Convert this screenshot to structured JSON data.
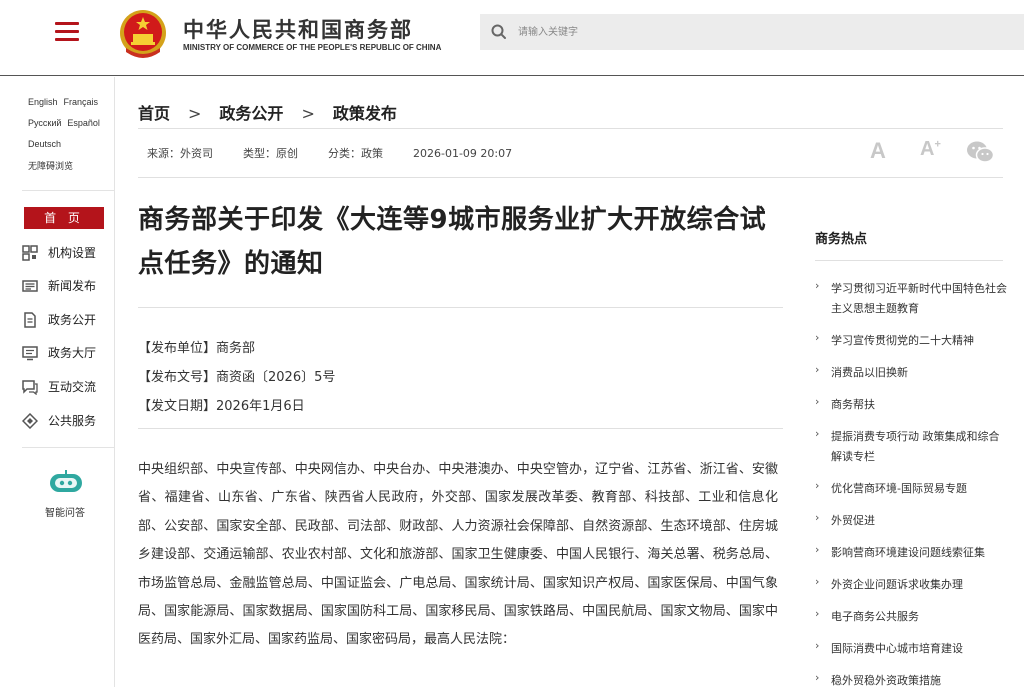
{
  "header": {
    "site_name_cn": "中华人民共和国商务部",
    "site_name_en": "MINISTRY OF COMMERCE OF THE PEOPLE'S REPUBLIC OF CHINA",
    "search_placeholder": "请输入关键字",
    "brand_color": "#b4141b"
  },
  "sidebar": {
    "languages": [
      [
        "English",
        "Français"
      ],
      [
        "Русский",
        "Español"
      ],
      [
        "Deutsch"
      ],
      [
        "无障碍浏览"
      ]
    ],
    "home_label": "首 页",
    "nav": [
      {
        "label": "机构设置",
        "icon": "grid-icon"
      },
      {
        "label": "新闻发布",
        "icon": "newspaper-icon"
      },
      {
        "label": "政务公开",
        "icon": "document-icon"
      },
      {
        "label": "政务大厅",
        "icon": "monitor-icon"
      },
      {
        "label": "互动交流",
        "icon": "chat-icon"
      },
      {
        "label": "公共服务",
        "icon": "service-icon"
      }
    ],
    "assistant_label": "智能问答"
  },
  "breadcrumb": [
    "首页",
    "政务公开",
    "政策发布"
  ],
  "meta": {
    "source": "来源：外资司",
    "type": "类型：原创",
    "category": "分类：政策",
    "datetime": "2026-01-09 20:07"
  },
  "tools": {
    "font_large": "A",
    "font_small": "A",
    "font_plus": "+"
  },
  "article": {
    "title": "商务部关于印发《大连等9城市服务业扩大开放综合试点任务》的通知",
    "issuer": "【发布单位】商务部",
    "doc_number": "【发布文号】商资函〔2026〕5号",
    "issue_date": "【发文日期】2026年1月6日",
    "body": "中央组织部、中央宣传部、中央网信办、中央台办、中央港澳办、中央空管办，辽宁省、江苏省、浙江省、安徽省、福建省、山东省、广东省、陕西省人民政府，外交部、国家发展改革委、教育部、科技部、工业和信息化部、公安部、国家安全部、民政部、司法部、财政部、人力资源社会保障部、自然资源部、生态环境部、住房城乡建设部、交通运输部、农业农村部、文化和旅游部、国家卫生健康委、中国人民银行、海关总署、税务总局、市场监管总局、金融监管总局、中国证监会、广电总局、国家统计局、国家知识产权局、国家医保局、中国气象局、国家能源局、国家数据局、国家国防科工局、国家移民局、国家铁路局、中国民航局、国家文物局、国家中医药局、国家外汇局、国家药监局、国家密码局，最高人民法院："
  },
  "hot": {
    "title": "商务热点",
    "items": [
      "学习贯彻习近平新时代中国特色社会主义思想主题教育",
      "学习宣传贯彻党的二十大精神",
      "消费品以旧换新",
      "商务帮扶",
      "提振消费专项行动 政策集成和综合解读专栏",
      "优化营商环境-国际贸易专题",
      "外贸促进",
      "影响营商环境建设问题线索征集",
      "外资企业问题诉求收集办理",
      "电子商务公共服务",
      "国际消费中心城市培育建设",
      "稳外贸稳外资政策措施"
    ]
  }
}
